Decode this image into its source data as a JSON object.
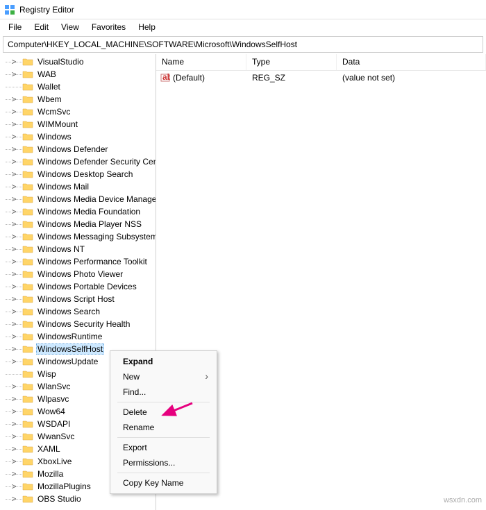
{
  "title": "Registry Editor",
  "menu": [
    "File",
    "Edit",
    "View",
    "Favorites",
    "Help"
  ],
  "address": "Computer\\HKEY_LOCAL_MACHINE\\SOFTWARE\\Microsoft\\WindowsSelfHost",
  "tree": [
    {
      "t": ">",
      "l": "VisualStudio"
    },
    {
      "t": ">",
      "l": "WAB"
    },
    {
      "t": "",
      "l": "Wallet"
    },
    {
      "t": ">",
      "l": "Wbem"
    },
    {
      "t": ">",
      "l": "WcmSvc"
    },
    {
      "t": ">",
      "l": "WIMMount"
    },
    {
      "t": ">",
      "l": "Windows"
    },
    {
      "t": ">",
      "l": "Windows Defender"
    },
    {
      "t": ">",
      "l": "Windows Defender Security Center"
    },
    {
      "t": ">",
      "l": "Windows Desktop Search"
    },
    {
      "t": ">",
      "l": "Windows Mail"
    },
    {
      "t": ">",
      "l": "Windows Media Device Manager"
    },
    {
      "t": ">",
      "l": "Windows Media Foundation"
    },
    {
      "t": ">",
      "l": "Windows Media Player NSS"
    },
    {
      "t": ">",
      "l": "Windows Messaging Subsystem"
    },
    {
      "t": ">",
      "l": "Windows NT"
    },
    {
      "t": ">",
      "l": "Windows Performance Toolkit"
    },
    {
      "t": ">",
      "l": "Windows Photo Viewer"
    },
    {
      "t": ">",
      "l": "Windows Portable Devices"
    },
    {
      "t": ">",
      "l": "Windows Script Host"
    },
    {
      "t": ">",
      "l": "Windows Search"
    },
    {
      "t": ">",
      "l": "Windows Security Health"
    },
    {
      "t": ">",
      "l": "WindowsRuntime"
    },
    {
      "t": ">",
      "l": "WindowsSelfHost",
      "sel": true
    },
    {
      "t": ">",
      "l": "WindowsUpdate"
    },
    {
      "t": "",
      "l": "Wisp"
    },
    {
      "t": ">",
      "l": "WlanSvc"
    },
    {
      "t": ">",
      "l": "Wlpasvc"
    },
    {
      "t": ">",
      "l": "Wow64"
    },
    {
      "t": ">",
      "l": "WSDAPI"
    },
    {
      "t": ">",
      "l": "WwanSvc"
    },
    {
      "t": ">",
      "l": "XAML"
    },
    {
      "t": ">",
      "l": "XboxLive"
    }
  ],
  "tree2": [
    {
      "t": ">",
      "l": "Mozilla",
      "d": 1
    },
    {
      "t": ">",
      "l": "MozillaPlugins",
      "d": 1
    },
    {
      "t": ">",
      "l": "OBS Studio",
      "d": 1
    }
  ],
  "lv": {
    "h": [
      "Name",
      "Type",
      "Data"
    ],
    "r": {
      "n": "(Default)",
      "t": "REG_SZ",
      "d": "(value not set)"
    }
  },
  "ctx": [
    "Expand",
    "New",
    "Find...",
    "-",
    "Delete",
    "Rename",
    "-",
    "Export",
    "Permissions...",
    "-",
    "Copy Key Name"
  ],
  "wm": "wsxdn.com"
}
